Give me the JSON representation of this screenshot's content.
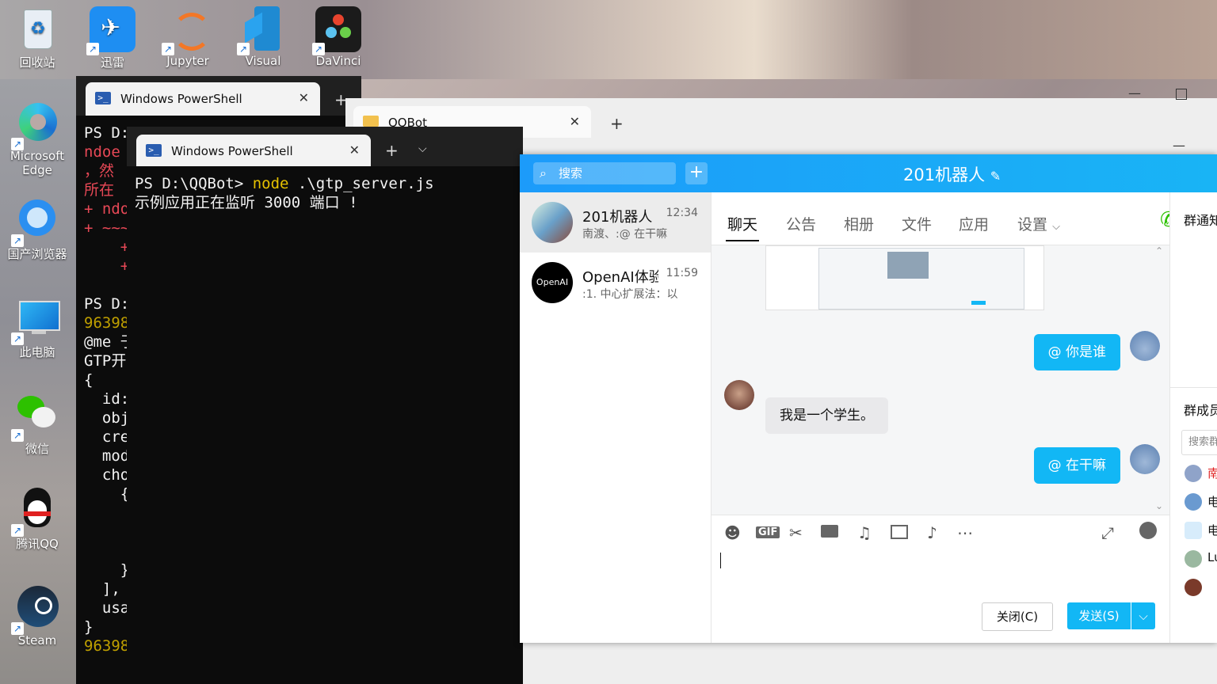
{
  "desktop": {
    "icons": [
      {
        "label": "回收站"
      },
      {
        "label": "迅雷"
      },
      {
        "label": "Jupyter"
      },
      {
        "label": "Visual"
      },
      {
        "label": "DaVinci"
      },
      {
        "label": "Microsoft Edge"
      },
      {
        "label": "国产浏览器"
      },
      {
        "label": "此电脑"
      },
      {
        "label": "微信"
      },
      {
        "label": "腾讯QQ"
      },
      {
        "label": "Steam"
      }
    ]
  },
  "ps_back": {
    "tab_title": "Windows PowerShell",
    "lines": [
      "PS D:",
      "ndoe",
      "，然",
      "所在",
      "+ ndo",
      "+ ~~~",
      "    +",
      "    +",
      "",
      "PS D:",
      "96398",
      "@me 于",
      "GTP开",
      "{",
      "  id:",
      "  obj",
      "  cre",
      "  mod",
      "  cho",
      "    {",
      "",
      "",
      "",
      "    }",
      "  ],",
      "  usa",
      "}",
      "96398"
    ]
  },
  "explorer": {
    "tab_title": "QQBot"
  },
  "ps_front": {
    "tab_title": "Windows PowerShell",
    "prompt": "PS D:\\QQBot> ",
    "command": "node",
    "args": " .\\gtp_server.js",
    "output": "示例应用正在监听 3000 端口 !"
  },
  "qq": {
    "search_placeholder": "搜索",
    "group_title": "201机器人",
    "conversations": [
      {
        "name": "201机器人",
        "time": "12:34",
        "preview": "南渡、:@     在干嘛"
      },
      {
        "name": "OpenAI体验",
        "time": "11:59",
        "preview": ":1. 中心扩展法：以"
      }
    ],
    "tabs": [
      "聊天",
      "公告",
      "相册",
      "文件",
      "应用",
      "设置"
    ],
    "messages": [
      {
        "from": "me",
        "text": "@     你是谁"
      },
      {
        "from": "other",
        "text": "我是一个学生。"
      },
      {
        "from": "me",
        "text": "@     在干嘛"
      }
    ],
    "toolbar_gif": "GIF",
    "close_button": "关闭(C)",
    "send_button": "发送(S)",
    "right_panel": {
      "notice_title": "群通知",
      "members_title": "群成员",
      "member_search": "搜索群",
      "members": [
        "南",
        "电",
        "电",
        "Lu",
        ""
      ]
    },
    "avatar_label": "OpenAI",
    "colors": {
      "accent": "#12b7f5",
      "header": "#1c9bfa"
    }
  }
}
